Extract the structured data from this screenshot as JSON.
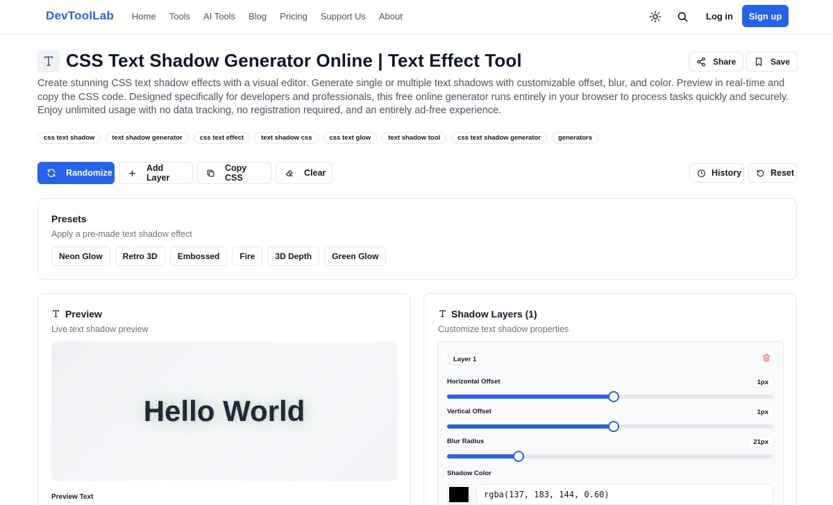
{
  "nav": {
    "logo": "DevToolLab",
    "links": [
      "Home",
      "Tools",
      "AI Tools",
      "Blog",
      "Pricing",
      "Support Us",
      "About"
    ],
    "login": "Log in",
    "signup": "Sign up",
    "theme_icon": "sun-icon",
    "search_icon": "search-icon"
  },
  "header": {
    "title_icon": "text-icon",
    "title": "CSS Text Shadow Generator Online | Text Effect Tool",
    "share": "Share",
    "save": "Save",
    "description": "Create stunning CSS text shadow effects with a visual editor. Generate single or multiple text shadows with customizable offset, blur, and color. Preview in real-time and copy the CSS code. Designed specifically for developers and professionals, this free online generator runs entirely in your browser to process tasks quickly and securely. Enjoy unlimited usage with no data tracking, no registration required, and an entirely ad-free experience."
  },
  "tags": [
    "css text shadow",
    "text shadow generator",
    "css text effect",
    "text shadow css",
    "css text glow",
    "text shadow tool",
    "css text shadow generator",
    "generators"
  ],
  "toolbar": {
    "randomize": "Randomize",
    "add_layer": "Add Layer",
    "copy_css": "Copy CSS",
    "clear": "Clear",
    "history": "History",
    "reset": "Reset"
  },
  "presets": {
    "title": "Presets",
    "subtitle": "Apply a pre-made text shadow effect",
    "items": [
      "Neon Glow",
      "Retro 3D",
      "Embossed",
      "Fire",
      "3D Depth",
      "Green Glow"
    ]
  },
  "preview": {
    "title": "Preview",
    "subtitle": "Live text shadow preview",
    "text": "Hello World",
    "preview_text_label": "Preview Text"
  },
  "layers": {
    "title": "Shadow Layers (1)",
    "subtitle": "Customize text shadow properties",
    "layer": {
      "name": "Layer 1",
      "horizontal_label": "Horizontal Offset",
      "horizontal_value": "1px",
      "horizontal_fraction": 0.51,
      "vertical_label": "Vertical Offset",
      "vertical_value": "1px",
      "vertical_fraction": 0.51,
      "blur_label": "Blur Radius",
      "blur_value": "21px",
      "blur_fraction": 0.22,
      "color_label": "Shadow Color",
      "color_value": "rgba(137, 183, 144, 0.60)",
      "swatch_color": "#000000"
    }
  },
  "colors": {
    "accent": "#2563eb",
    "danger": "#f87171"
  }
}
